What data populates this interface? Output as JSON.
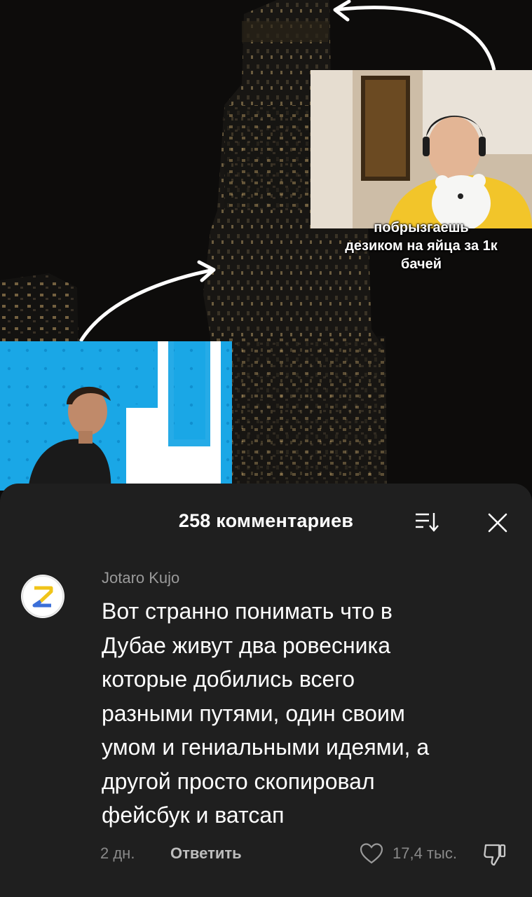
{
  "video": {
    "caption": "побрызгаешь\nдезиком на яйца за 1к\nбачей",
    "logo_fragment": "DU"
  },
  "comments_panel": {
    "count_label": "258 комментариев",
    "sort_icon": "sort-icon",
    "close_icon": "close-icon"
  },
  "comment": {
    "avatar_letter": "Z",
    "author": "Jotaro Kujo",
    "text": "Вот странно понимать что в\nДубае живут два ровесника\nкоторые добились всего\nразными путями, один своим\nумом и гениальными идеями, а\nдругой просто скопировал\nфейсбук и ватсап",
    "time": "2 дн.",
    "reply_label": "Ответить",
    "like_count": "17,4 тыс.",
    "like_icon": "heart-outline-icon",
    "dislike_icon": "thumbs-down-icon"
  },
  "colors": {
    "sheet_bg": "#1f1f1f",
    "inset_blue": "#1aa7e6",
    "avatar_yellow": "#f0c419",
    "avatar_blue": "#3b6fd8"
  }
}
